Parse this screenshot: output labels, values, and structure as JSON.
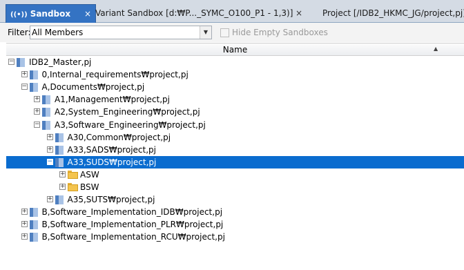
{
  "tabs": [
    {
      "label": "Sandbox",
      "icon": "sandbox-icon",
      "active": true
    },
    {
      "label": "Variant Sandbox [d:₩P..._SYMC_O100_P1 - 1,3)]",
      "active": false
    },
    {
      "label": "Project [/IDB2_HKMC_JG/project,pj]",
      "active": false
    }
  ],
  "filter": {
    "label": "Filter:",
    "value": "All Members",
    "hide_empty_label": "Hide Empty Sandboxes"
  },
  "columns": {
    "name": "Name"
  },
  "tree": [
    {
      "label": "IDB2_Master,pj",
      "level": 0,
      "icon": "project",
      "expander": "minus"
    },
    {
      "label": "0,Internal_requirements₩project,pj",
      "level": 1,
      "icon": "project",
      "expander": "plus"
    },
    {
      "label": "A,Documents₩project,pj",
      "level": 1,
      "icon": "project",
      "expander": "minus"
    },
    {
      "label": "A1,Management₩project,pj",
      "level": 2,
      "icon": "project",
      "expander": "plus"
    },
    {
      "label": "A2,System_Engineering₩project,pj",
      "level": 2,
      "icon": "project",
      "expander": "plus"
    },
    {
      "label": "A3,Software_Engineering₩project,pj",
      "level": 2,
      "icon": "project",
      "expander": "minus"
    },
    {
      "label": "A30,Common₩project,pj",
      "level": 3,
      "icon": "project",
      "expander": "plus"
    },
    {
      "label": "A33,SADS₩project,pj",
      "level": 3,
      "icon": "project",
      "expander": "plus"
    },
    {
      "label": "A33,SUDS₩project,pj",
      "level": 3,
      "icon": "project",
      "expander": "minus",
      "selected": true
    },
    {
      "label": "ASW",
      "level": 4,
      "icon": "folder",
      "expander": "plus"
    },
    {
      "label": "BSW",
      "level": 4,
      "icon": "folder",
      "expander": "plus"
    },
    {
      "label": "A35,SUTS₩project,pj",
      "level": 3,
      "icon": "project",
      "expander": "plus"
    },
    {
      "label": "B,Software_Implementation_IDB₩project,pj",
      "level": 1,
      "icon": "project",
      "expander": "plus"
    },
    {
      "label": "B,Software_Implementation_PLR₩project,pj",
      "level": 1,
      "icon": "project",
      "expander": "plus"
    },
    {
      "label": "B,Software_Implementation_RCU₩project,pj",
      "level": 1,
      "icon": "project",
      "expander": "plus"
    }
  ],
  "colors": {
    "selection": "#0a6ccf",
    "active_tab": "#3473c3"
  }
}
